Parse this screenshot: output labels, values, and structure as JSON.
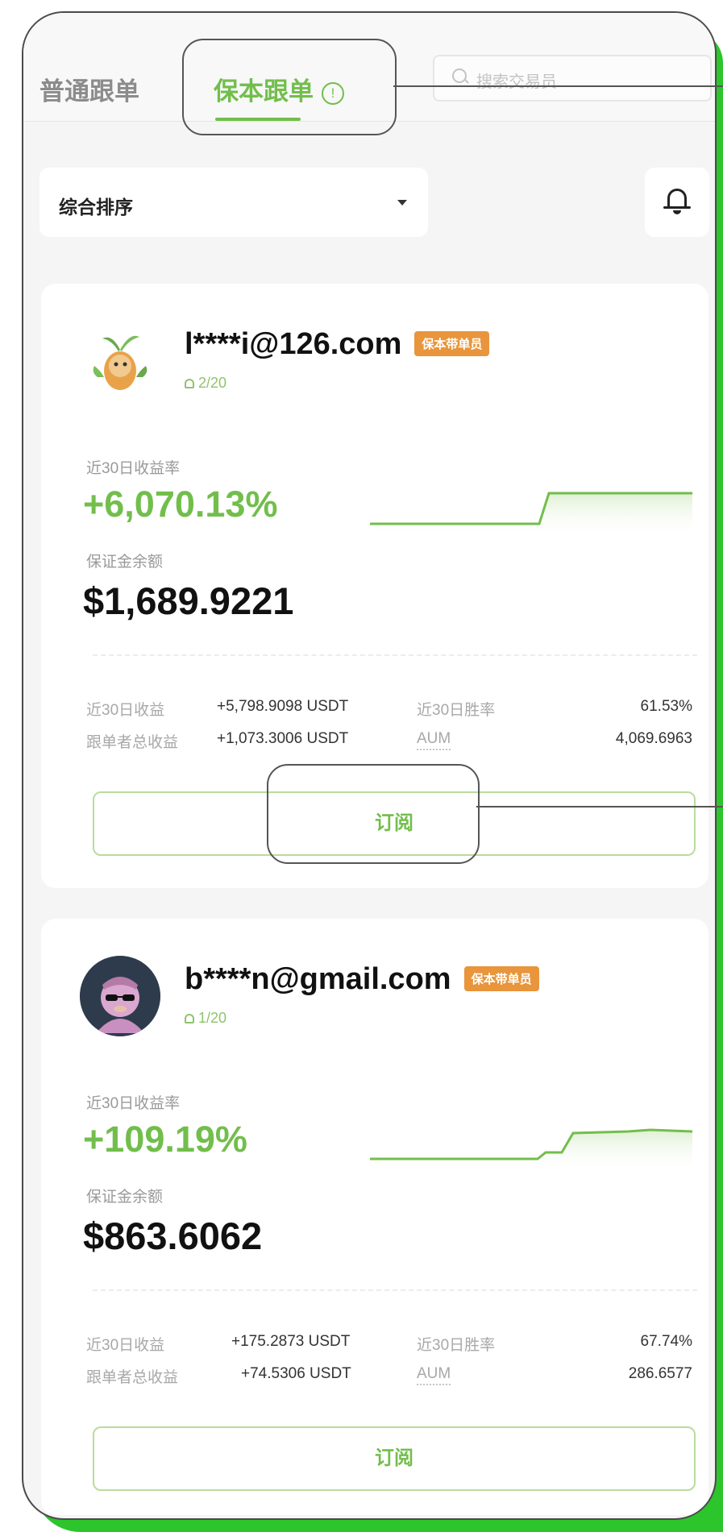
{
  "tabs": {
    "normal_label": "普通跟单",
    "active_label": "保本跟单",
    "info_icon": "info-circle-icon"
  },
  "search": {
    "placeholder": "搜索交易员"
  },
  "sort": {
    "label": "综合排序"
  },
  "bell_icon": "bell-icon",
  "traders": [
    {
      "name": "l****i@126.com",
      "badge": "保本带单员",
      "followers": "2/20",
      "roi_label": "近30日收益率",
      "roi": "+6,070.13%",
      "margin_label": "保证金余额",
      "margin": "$1,689.9221",
      "stats": {
        "profit_label": "近30日收益",
        "profit": "+5,798.9098 USDT",
        "winrate_label": "近30日胜率",
        "winrate": "61.53%",
        "follower_profit_label": "跟单者总收益",
        "follower_profit": "+1,073.3006 USDT",
        "aum_label": "AUM",
        "aum": "4,069.6963"
      },
      "subscribe_label": "订阅"
    },
    {
      "name": "b****n@gmail.com",
      "badge": "保本带单员",
      "followers": "1/20",
      "roi_label": "近30日收益率",
      "roi": "+109.19%",
      "margin_label": "保证金余额",
      "margin": "$863.6062",
      "stats": {
        "profit_label": "近30日收益",
        "profit": "+175.2873 USDT",
        "winrate_label": "近30日胜率",
        "winrate": "67.74%",
        "follower_profit_label": "跟单者总收益",
        "follower_profit": "+74.5306 USDT",
        "aum_label": "AUM",
        "aum": "286.6577"
      },
      "subscribe_label": "订阅"
    }
  ],
  "colors": {
    "accent_green": "#72be4c",
    "badge_orange": "#e8953c",
    "frame_green": "#2cc52c"
  }
}
